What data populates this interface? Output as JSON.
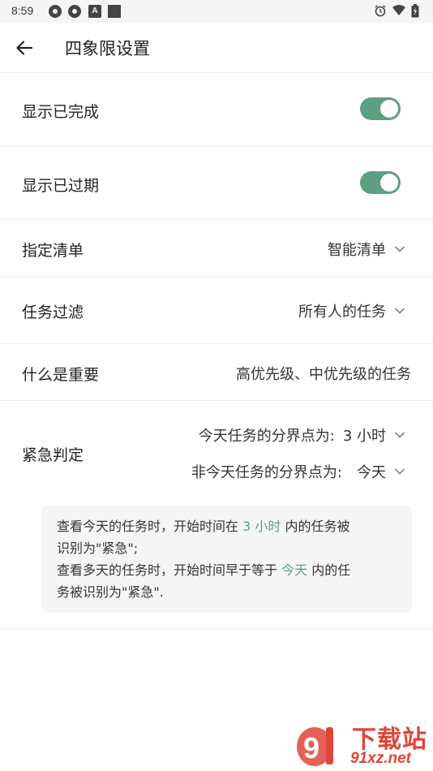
{
  "status_bar": {
    "time": "8:59",
    "left_icons": [
      "gear-icon",
      "gear-icon",
      "a-badge-icon",
      "square-icon"
    ],
    "a_badge_text": "A",
    "right_icons": [
      "alarm-icon",
      "wifi-icon",
      "battery-icon"
    ]
  },
  "app_bar": {
    "title": "四象限设置",
    "back_icon": "arrow-left-icon"
  },
  "settings": {
    "show_completed": {
      "label": "显示已完成",
      "enabled": true
    },
    "show_overdue": {
      "label": "显示已过期",
      "enabled": true
    },
    "assigned_list": {
      "label": "指定清单",
      "value": "智能清单"
    },
    "task_filter": {
      "label": "任务过滤",
      "value": "所有人的任务"
    },
    "important": {
      "label": "什么是重要",
      "value": "高优先级、中优先级的任务"
    },
    "urgent": {
      "label": "紧急判定",
      "today_boundary_label": "今天任务的分界点为:",
      "today_boundary_value": "3 小时",
      "non_today_boundary_label": "非今天任务的分界点为:",
      "non_today_boundary_value": "今天"
    }
  },
  "info": {
    "line1_prefix": "查看今天的任务时，开始时间在 ",
    "line1_highlight": "3 小时",
    "line1_suffix": " 内的任务被",
    "line2": "识别为\"紧急\";",
    "line3_prefix": "查看多天的任务时，开始时间早于等于 ",
    "line3_highlight": "今天",
    "line3_suffix": " 内的任",
    "line4": "务被识别为\"紧急\"."
  },
  "watermark": {
    "title": "下载站",
    "domain": "91xz.net"
  },
  "colors": {
    "accent": "#5e9e83",
    "watermark": "#e0453a",
    "divider": "#ececec",
    "info_bg": "#f5f5f5"
  }
}
